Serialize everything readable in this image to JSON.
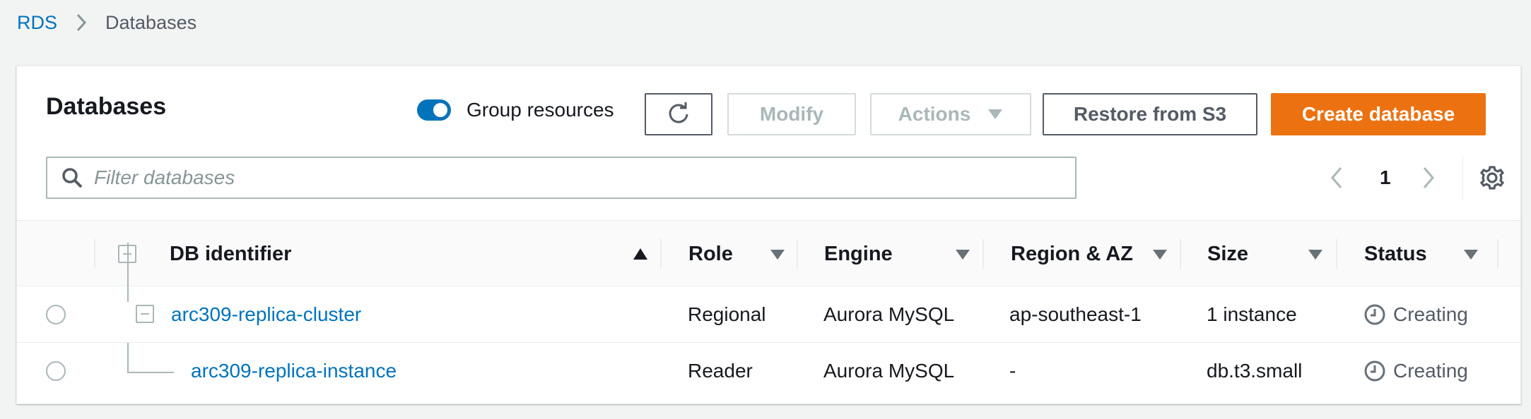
{
  "breadcrumb": {
    "root": "RDS",
    "current": "Databases"
  },
  "panel": {
    "title": "Databases",
    "group_resources_label": "Group resources",
    "group_resources_on": true,
    "buttons": {
      "modify": "Modify",
      "actions": "Actions",
      "restore": "Restore from S3",
      "create": "Create database"
    },
    "search_placeholder": "Filter databases",
    "page_number": "1"
  },
  "table": {
    "columns": {
      "identifier": "DB identifier",
      "role": "Role",
      "engine": "Engine",
      "region": "Region & AZ",
      "size": "Size",
      "status": "Status"
    },
    "rows": [
      {
        "identifier": "arc309-replica-cluster",
        "role": "Regional",
        "engine": "Aurora MySQL",
        "region": "ap-southeast-1",
        "size": "1 instance",
        "status": "Creating"
      },
      {
        "identifier": "arc309-replica-instance",
        "role": "Reader",
        "engine": "Aurora MySQL",
        "region": "-",
        "size": "db.t3.small",
        "status": "Creating"
      }
    ]
  },
  "colors": {
    "link": "#0073bb",
    "primary_button": "#ec7211",
    "toggle_on": "#0073bb"
  }
}
